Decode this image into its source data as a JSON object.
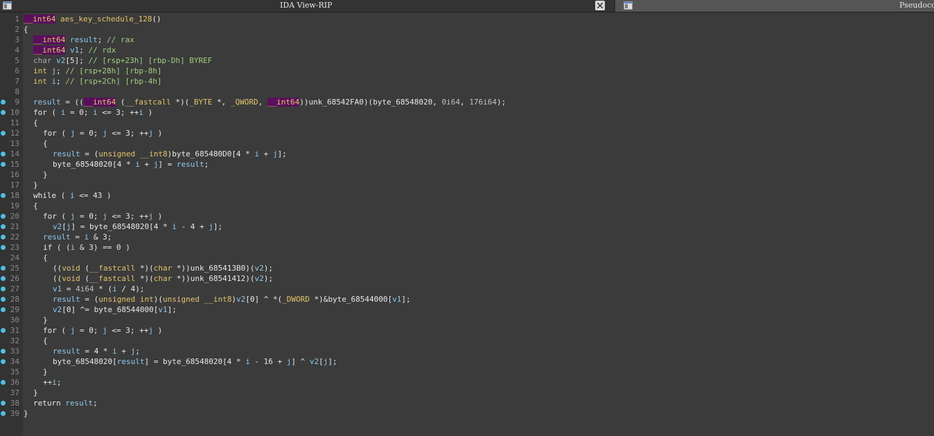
{
  "tabs": [
    {
      "title": "IDA View-RIP",
      "icon": "window-icon"
    },
    {
      "title": "Pseudocode",
      "icon": "window-icon"
    }
  ],
  "close_label": "close",
  "lines": [
    {
      "n": "1",
      "bp": false,
      "indent": 0,
      "tokens": [
        [
          "hl",
          "__int64"
        ],
        [
          "t",
          " "
        ],
        [
          "fn",
          "aes_key_schedule_128"
        ],
        [
          "t",
          "()"
        ]
      ]
    },
    {
      "n": "2",
      "bp": false,
      "indent": 0,
      "tokens": [
        [
          "t",
          "{"
        ]
      ]
    },
    {
      "n": "3",
      "bp": false,
      "indent": 1,
      "tokens": [
        [
          "hl",
          "__int64"
        ],
        [
          "t",
          " "
        ],
        [
          "var",
          "result"
        ],
        [
          "t",
          "; "
        ],
        [
          "cm",
          "// rax"
        ]
      ]
    },
    {
      "n": "4",
      "bp": false,
      "indent": 1,
      "tokens": [
        [
          "hl",
          "__int64"
        ],
        [
          "t",
          " "
        ],
        [
          "var",
          "v1"
        ],
        [
          "t",
          "; "
        ],
        [
          "cm",
          "// rdx"
        ]
      ]
    },
    {
      "n": "5",
      "bp": false,
      "indent": 1,
      "tokens": [
        [
          "grey",
          "char"
        ],
        [
          "t",
          " "
        ],
        [
          "var",
          "v2"
        ],
        [
          "t",
          "[5]; "
        ],
        [
          "cm",
          "// [rsp+23h] [rbp-Dh] BYREF"
        ]
      ]
    },
    {
      "n": "6",
      "bp": false,
      "indent": 1,
      "tokens": [
        [
          "ty",
          "int"
        ],
        [
          "t",
          " "
        ],
        [
          "var",
          "j"
        ],
        [
          "t",
          "; "
        ],
        [
          "cm",
          "// [rsp+28h] [rbp-8h]"
        ]
      ]
    },
    {
      "n": "7",
      "bp": false,
      "indent": 1,
      "tokens": [
        [
          "ty",
          "int"
        ],
        [
          "t",
          " "
        ],
        [
          "var",
          "i"
        ],
        [
          "t",
          "; "
        ],
        [
          "cm",
          "// [rsp+2Ch] [rbp-4h]"
        ]
      ]
    },
    {
      "n": "8",
      "bp": false,
      "indent": 0,
      "tokens": []
    },
    {
      "n": "9",
      "bp": true,
      "indent": 1,
      "tokens": [
        [
          "var",
          "result"
        ],
        [
          "t",
          " = (("
        ],
        [
          "hl",
          "__int64"
        ],
        [
          "t",
          " ("
        ],
        [
          "ty",
          "__fastcall"
        ],
        [
          "t",
          " *)("
        ],
        [
          "ty",
          "_BYTE"
        ],
        [
          "t",
          " *, "
        ],
        [
          "ty",
          "_QWORD"
        ],
        [
          "t",
          ", "
        ],
        [
          "hl",
          "__int64"
        ],
        [
          "t",
          "))"
        ],
        [
          "glb",
          "unk_68542FA0"
        ],
        [
          "t",
          ")("
        ],
        [
          "glb",
          "byte_68548020"
        ],
        [
          "t",
          ", "
        ],
        [
          "num",
          "0i64"
        ],
        [
          "t",
          ", "
        ],
        [
          "num",
          "176i64"
        ],
        [
          "t",
          ");"
        ]
      ]
    },
    {
      "n": "10",
      "bp": true,
      "indent": 1,
      "tokens": [
        [
          "kw",
          "for"
        ],
        [
          "t",
          " ( "
        ],
        [
          "var",
          "i"
        ],
        [
          "t",
          " = 0; "
        ],
        [
          "var",
          "i"
        ],
        [
          "t",
          " <= 3; ++"
        ],
        [
          "var",
          "i"
        ],
        [
          "t",
          " )"
        ]
      ]
    },
    {
      "n": "11",
      "bp": false,
      "indent": 1,
      "tokens": [
        [
          "t",
          "{"
        ]
      ]
    },
    {
      "n": "12",
      "bp": true,
      "indent": 2,
      "tokens": [
        [
          "kw",
          "for"
        ],
        [
          "t",
          " ( "
        ],
        [
          "var",
          "j"
        ],
        [
          "t",
          " = 0; "
        ],
        [
          "var",
          "j"
        ],
        [
          "t",
          " <= 3; ++"
        ],
        [
          "var",
          "j"
        ],
        [
          "t",
          " )"
        ]
      ]
    },
    {
      "n": "13",
      "bp": false,
      "indent": 2,
      "tokens": [
        [
          "t",
          "{"
        ]
      ]
    },
    {
      "n": "14",
      "bp": true,
      "indent": 3,
      "tokens": [
        [
          "var",
          "result"
        ],
        [
          "t",
          " = ("
        ],
        [
          "ty",
          "unsigned __int8"
        ],
        [
          "t",
          ")"
        ],
        [
          "glb",
          "byte_685480D0"
        ],
        [
          "t",
          "[4 * "
        ],
        [
          "var",
          "i"
        ],
        [
          "t",
          " + "
        ],
        [
          "var",
          "j"
        ],
        [
          "t",
          "];"
        ]
      ]
    },
    {
      "n": "15",
      "bp": true,
      "indent": 3,
      "tokens": [
        [
          "glb",
          "byte_68548020"
        ],
        [
          "t",
          "[4 * "
        ],
        [
          "var",
          "i"
        ],
        [
          "t",
          " + "
        ],
        [
          "var",
          "j"
        ],
        [
          "t",
          "] = "
        ],
        [
          "var",
          "result"
        ],
        [
          "t",
          ";"
        ]
      ]
    },
    {
      "n": "16",
      "bp": false,
      "indent": 2,
      "tokens": [
        [
          "t",
          "}"
        ]
      ]
    },
    {
      "n": "17",
      "bp": false,
      "indent": 1,
      "tokens": [
        [
          "t",
          "}"
        ]
      ]
    },
    {
      "n": "18",
      "bp": true,
      "indent": 1,
      "tokens": [
        [
          "kw",
          "while"
        ],
        [
          "t",
          " ( "
        ],
        [
          "var",
          "i"
        ],
        [
          "t",
          " <= 43 )"
        ]
      ]
    },
    {
      "n": "19",
      "bp": false,
      "indent": 1,
      "tokens": [
        [
          "t",
          "{"
        ]
      ]
    },
    {
      "n": "20",
      "bp": true,
      "indent": 2,
      "tokens": [
        [
          "kw",
          "for"
        ],
        [
          "t",
          " ( "
        ],
        [
          "var",
          "j"
        ],
        [
          "t",
          " = 0; "
        ],
        [
          "var",
          "j"
        ],
        [
          "t",
          " <= 3; ++"
        ],
        [
          "var",
          "j"
        ],
        [
          "t",
          " )"
        ]
      ]
    },
    {
      "n": "21",
      "bp": true,
      "indent": 3,
      "tokens": [
        [
          "var",
          "v2"
        ],
        [
          "t",
          "["
        ],
        [
          "var",
          "j"
        ],
        [
          "t",
          "] = "
        ],
        [
          "glb",
          "byte_68548020"
        ],
        [
          "t",
          "[4 * "
        ],
        [
          "var",
          "i"
        ],
        [
          "t",
          " - 4 + "
        ],
        [
          "var",
          "j"
        ],
        [
          "t",
          "];"
        ]
      ]
    },
    {
      "n": "22",
      "bp": true,
      "indent": 2,
      "tokens": [
        [
          "var",
          "result"
        ],
        [
          "t",
          " = "
        ],
        [
          "var",
          "i"
        ],
        [
          "t",
          " & 3;"
        ]
      ]
    },
    {
      "n": "23",
      "bp": true,
      "indent": 2,
      "tokens": [
        [
          "kw",
          "if"
        ],
        [
          "t",
          " ( ("
        ],
        [
          "var",
          "i"
        ],
        [
          "t",
          " & 3) == 0 )"
        ]
      ]
    },
    {
      "n": "24",
      "bp": false,
      "indent": 2,
      "tokens": [
        [
          "t",
          "{"
        ]
      ]
    },
    {
      "n": "25",
      "bp": true,
      "indent": 3,
      "tokens": [
        [
          "t",
          "(("
        ],
        [
          "ty",
          "void"
        ],
        [
          "t",
          " ("
        ],
        [
          "ty",
          "__fastcall"
        ],
        [
          "t",
          " *)("
        ],
        [
          "ty",
          "char"
        ],
        [
          "t",
          " *))"
        ],
        [
          "glb",
          "unk_685413B0"
        ],
        [
          "t",
          ")("
        ],
        [
          "var",
          "v2"
        ],
        [
          "t",
          ");"
        ]
      ]
    },
    {
      "n": "26",
      "bp": true,
      "indent": 3,
      "tokens": [
        [
          "t",
          "(("
        ],
        [
          "ty",
          "void"
        ],
        [
          "t",
          " ("
        ],
        [
          "ty",
          "__fastcall"
        ],
        [
          "t",
          " *)("
        ],
        [
          "ty",
          "char"
        ],
        [
          "t",
          " *))"
        ],
        [
          "glb",
          "unk_68541412"
        ],
        [
          "t",
          ")("
        ],
        [
          "var",
          "v2"
        ],
        [
          "t",
          ");"
        ]
      ]
    },
    {
      "n": "27",
      "bp": true,
      "indent": 3,
      "tokens": [
        [
          "var",
          "v1"
        ],
        [
          "t",
          " = "
        ],
        [
          "num",
          "4i64"
        ],
        [
          "t",
          " * ("
        ],
        [
          "var",
          "i"
        ],
        [
          "t",
          " / 4);"
        ]
      ]
    },
    {
      "n": "28",
      "bp": true,
      "indent": 3,
      "tokens": [
        [
          "var",
          "result"
        ],
        [
          "t",
          " = ("
        ],
        [
          "ty",
          "unsigned int"
        ],
        [
          "t",
          ")("
        ],
        [
          "ty",
          "unsigned __int8"
        ],
        [
          "t",
          ")"
        ],
        [
          "var",
          "v2"
        ],
        [
          "t",
          "[0] ^ *("
        ],
        [
          "ty",
          "_DWORD"
        ],
        [
          "t",
          " *)&"
        ],
        [
          "glb",
          "byte_68544000"
        ],
        [
          "t",
          "["
        ],
        [
          "var",
          "v1"
        ],
        [
          "t",
          "];"
        ]
      ]
    },
    {
      "n": "29",
      "bp": true,
      "indent": 3,
      "tokens": [
        [
          "var",
          "v2"
        ],
        [
          "t",
          "[0] ^= "
        ],
        [
          "glb",
          "byte_68544000"
        ],
        [
          "t",
          "["
        ],
        [
          "var",
          "v1"
        ],
        [
          "t",
          "];"
        ]
      ]
    },
    {
      "n": "30",
      "bp": false,
      "indent": 2,
      "tokens": [
        [
          "t",
          "}"
        ]
      ]
    },
    {
      "n": "31",
      "bp": true,
      "indent": 2,
      "tokens": [
        [
          "kw",
          "for"
        ],
        [
          "t",
          " ( "
        ],
        [
          "var",
          "j"
        ],
        [
          "t",
          " = 0; "
        ],
        [
          "var",
          "j"
        ],
        [
          "t",
          " <= 3; ++"
        ],
        [
          "var",
          "j"
        ],
        [
          "t",
          " )"
        ]
      ]
    },
    {
      "n": "32",
      "bp": false,
      "indent": 2,
      "tokens": [
        [
          "t",
          "{"
        ]
      ]
    },
    {
      "n": "33",
      "bp": true,
      "indent": 3,
      "tokens": [
        [
          "var",
          "result"
        ],
        [
          "t",
          " = 4 * "
        ],
        [
          "var",
          "i"
        ],
        [
          "t",
          " + "
        ],
        [
          "var",
          "j"
        ],
        [
          "t",
          ";"
        ]
      ]
    },
    {
      "n": "34",
      "bp": true,
      "indent": 3,
      "tokens": [
        [
          "glb",
          "byte_68548020"
        ],
        [
          "t",
          "["
        ],
        [
          "var",
          "result"
        ],
        [
          "t",
          "] = "
        ],
        [
          "glb",
          "byte_68548020"
        ],
        [
          "t",
          "[4 * "
        ],
        [
          "var",
          "i"
        ],
        [
          "t",
          " - 16 + "
        ],
        [
          "var",
          "j"
        ],
        [
          "t",
          "] ^ "
        ],
        [
          "var",
          "v2"
        ],
        [
          "t",
          "["
        ],
        [
          "var",
          "j"
        ],
        [
          "t",
          "];"
        ]
      ]
    },
    {
      "n": "35",
      "bp": false,
      "indent": 2,
      "tokens": [
        [
          "t",
          "}"
        ]
      ]
    },
    {
      "n": "36",
      "bp": true,
      "indent": 2,
      "tokens": [
        [
          "t",
          "++"
        ],
        [
          "var",
          "i"
        ],
        [
          "t",
          ";"
        ]
      ]
    },
    {
      "n": "37",
      "bp": false,
      "indent": 1,
      "tokens": [
        [
          "t",
          "}"
        ]
      ]
    },
    {
      "n": "38",
      "bp": true,
      "indent": 1,
      "tokens": [
        [
          "kw",
          "return"
        ],
        [
          "t",
          " "
        ],
        [
          "var",
          "result"
        ],
        [
          "t",
          ";"
        ]
      ]
    },
    {
      "n": "39",
      "bp": true,
      "indent": 0,
      "tokens": [
        [
          "t",
          "}"
        ]
      ]
    }
  ],
  "colors": {
    "background": "#3b3b3b",
    "gutter": "#333333",
    "breakpoint": "#4fc1e9",
    "type": "#e3c46b",
    "variable": "#8fc9ef",
    "comment": "#9fd07c",
    "highlight": "#5a0f5c"
  }
}
